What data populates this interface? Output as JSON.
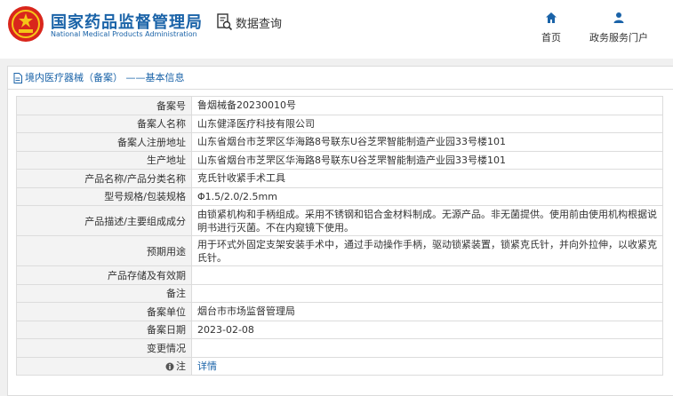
{
  "header": {
    "logo_cn": "国家药品监督管理局",
    "logo_en": "National Medical Products Administration",
    "query_label": "数据查询",
    "nav": {
      "home": "首页",
      "portal": "政务服务门户"
    }
  },
  "panel": {
    "title": "境内医疗器械（备案） ——基本信息"
  },
  "rows": [
    {
      "label": "备案号",
      "value": "鲁烟械备20230010号"
    },
    {
      "label": "备案人名称",
      "value": "山东健泽医疗科技有限公司"
    },
    {
      "label": "备案人注册地址",
      "value": "山东省烟台市芝罘区华海路8号联东U谷芝罘智能制造产业园33号楼101"
    },
    {
      "label": "生产地址",
      "value": "山东省烟台市芝罘区华海路8号联东U谷芝罘智能制造产业园33号楼101"
    },
    {
      "label": "产品名称/产品分类名称",
      "value": "克氏针收紧手术工具"
    },
    {
      "label": "型号规格/包装规格",
      "value": "Φ1.5/2.0/2.5mm"
    },
    {
      "label": "产品描述/主要组成成分",
      "value": "由锁紧机构和手柄组成。采用不锈钢和铝合金材料制成。无源产品。非无菌提供。使用前由使用机构根据说明书进行灭菌。不在内窥镜下使用。"
    },
    {
      "label": "预期用途",
      "value": "用于环式外固定支架安装手术中，通过手动操作手柄，驱动锁紧装置，锁紧克氏针，并向外拉伸，以收紧克氏针。"
    },
    {
      "label": "产品存储及有效期",
      "value": ""
    },
    {
      "label": "备注",
      "value": ""
    },
    {
      "label": "备案单位",
      "value": "烟台市市场监督管理局"
    },
    {
      "label": "备案日期",
      "value": "2023-02-08"
    },
    {
      "label": "变更情况",
      "value": ""
    }
  ],
  "note_row": {
    "label": "注",
    "link": "详情"
  },
  "colors": {
    "brand_blue": "#1a63a8",
    "seal_red": "#d9261c",
    "label_bg": "#f3f3f3",
    "border": "#dcdcdc"
  },
  "icons": {
    "emblem": "national-emblem",
    "query": "search-document-icon",
    "home": "home-icon",
    "portal": "user-icon",
    "panel_title": "document-icon",
    "note": "info-icon"
  }
}
